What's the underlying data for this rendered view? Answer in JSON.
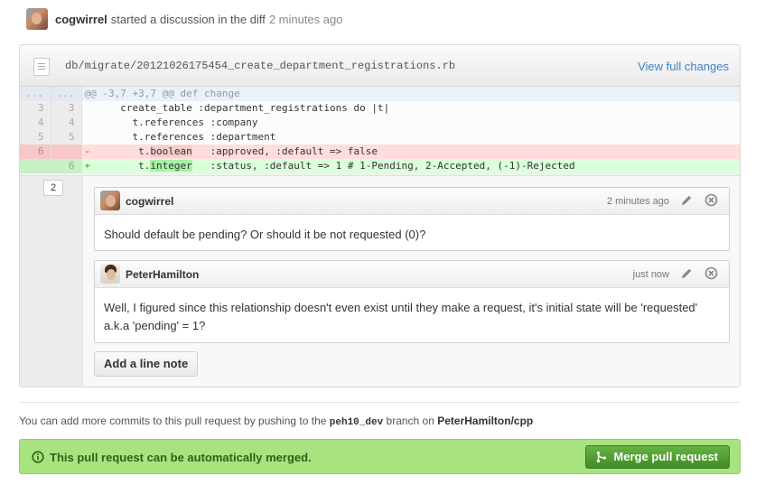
{
  "header": {
    "user": "cogwirrel",
    "action": "started a discussion in the diff",
    "time": "2 minutes ago",
    "avatar_icon": "user-avatar-icon"
  },
  "file": {
    "path": "db/migrate/20121026175454_create_department_registrations.rb",
    "view_full_label": "View full changes",
    "icon": "file-icon"
  },
  "diff": {
    "rows": [
      {
        "type": "hunk",
        "old": "...",
        "new": "...",
        "sign": "",
        "code": "@@ -3,7 +3,7 @@ def change",
        "hl": ""
      },
      {
        "type": "ctx",
        "old": "3",
        "new": "3",
        "sign": "",
        "code": "      create_table :department_registrations do |t|",
        "hl": ""
      },
      {
        "type": "ctx",
        "old": "4",
        "new": "4",
        "sign": "",
        "code": "        t.references :company",
        "hl": ""
      },
      {
        "type": "ctx",
        "old": "5",
        "new": "5",
        "sign": "",
        "code": "        t.references :department",
        "hl": ""
      },
      {
        "type": "del",
        "old": "6",
        "new": "",
        "sign": "-",
        "code": "        t.",
        "hl": "boolean",
        "rest": "   :approved, :default => false"
      },
      {
        "type": "add",
        "old": "",
        "new": "6",
        "sign": "+",
        "code": "        t.",
        "hl": "integer",
        "rest": "   :status, :default => 1 # 1-Pending, 2-Accepted, (-1)-Rejected"
      }
    ]
  },
  "discussion": {
    "comment_count": "2",
    "comments": [
      {
        "author": "cogwirrel",
        "time": "2 minutes ago",
        "body": "Should default be pending? Or should it be not requested (0)?"
      },
      {
        "author": "PeterHamilton",
        "time": "just now",
        "body": "Well, I figured since this relationship doesn't even exist until they make a request, it's initial state will be 'requested' a.k.a 'pending' = 1?"
      }
    ],
    "add_note_label": "Add a line note"
  },
  "push_info": {
    "prefix": "You can add more commits to this pull request by pushing to the ",
    "branch": "peh10_dev",
    "middle": " branch on ",
    "repo": "PeterHamilton/cpp"
  },
  "merge": {
    "message": "This pull request can be automatically merged.",
    "button_label": "Merge pull request",
    "status_color": "#a9e37f",
    "button_color": "#4f9e32"
  }
}
